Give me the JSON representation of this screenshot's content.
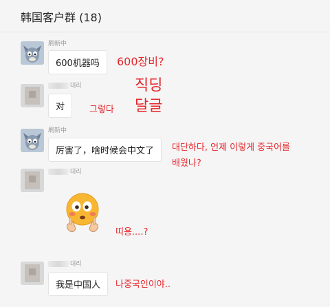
{
  "header": {
    "title": "韩国客户群 (18)"
  },
  "messages": [
    {
      "sender": "刷新中",
      "text": "600机器吗",
      "annotation": "600장비?"
    },
    {
      "sender": "대리",
      "text": "对",
      "annotation": "그렇다",
      "annotation2": "직딩\n달글"
    },
    {
      "sender": "刷新中",
      "text": "厉害了，啥时候会中文了",
      "annotation": "대단하다, 언제 이렇게 중국어를\n배웠나?"
    },
    {
      "sender": "대리",
      "annotation": "띠용....?",
      "sticker": "flushed-face-emoji"
    },
    {
      "sender": "대리",
      "text": "我是中国人",
      "annotation": "나중국인이야.."
    }
  ],
  "colors": {
    "annotation": "#e6262b",
    "bubble": "#ffffff",
    "background": "#f5f5f5"
  }
}
